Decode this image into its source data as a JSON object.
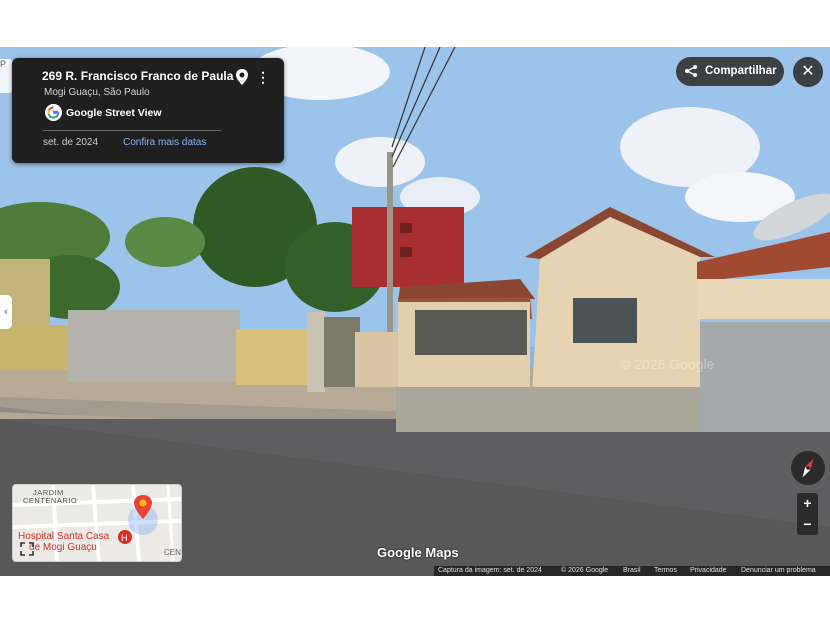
{
  "location": {
    "title": "269 R. Francisco Franco de Paula",
    "subtitle": "Mogi Guaçu, São Paulo",
    "service_label": "Google Street View",
    "capture_date": "set. de 2024",
    "more_dates_link": "Confira mais datas",
    "peek_text": "P"
  },
  "toolbar": {
    "share_label": "Compartilhar",
    "close_label": "✕"
  },
  "controls": {
    "zoom_in": "+",
    "zoom_out": "−",
    "nav_left": "‹"
  },
  "minimap": {
    "area_label_1": "JARDIM",
    "area_label_2": "CENTENARIO",
    "poi_line_1": "Hospital Santa Casa",
    "poi_line_2": "de Mogi Guaçu",
    "cut_label": "CEN"
  },
  "branding": {
    "logo_text": "Google Maps"
  },
  "footer": {
    "capture": "Captura da imagem: set. de 2024",
    "copyright": "© 2026 Google",
    "country": "Brasil",
    "terms": "Termos",
    "privacy": "Privacidade",
    "report": "Denunciar um problema"
  },
  "watermark": "© 2026 Google",
  "colors": {
    "panel_bg": "#1f1f1f",
    "link": "#8ab4f8",
    "button_bg": "#3c4043",
    "hospital_red": "#d93025"
  },
  "icons": [
    "pin-icon",
    "more-vert-icon",
    "google-g-icon",
    "share-icon",
    "close-icon",
    "compass-icon",
    "expand-icon",
    "hospital-icon",
    "map-marker-icon"
  ]
}
